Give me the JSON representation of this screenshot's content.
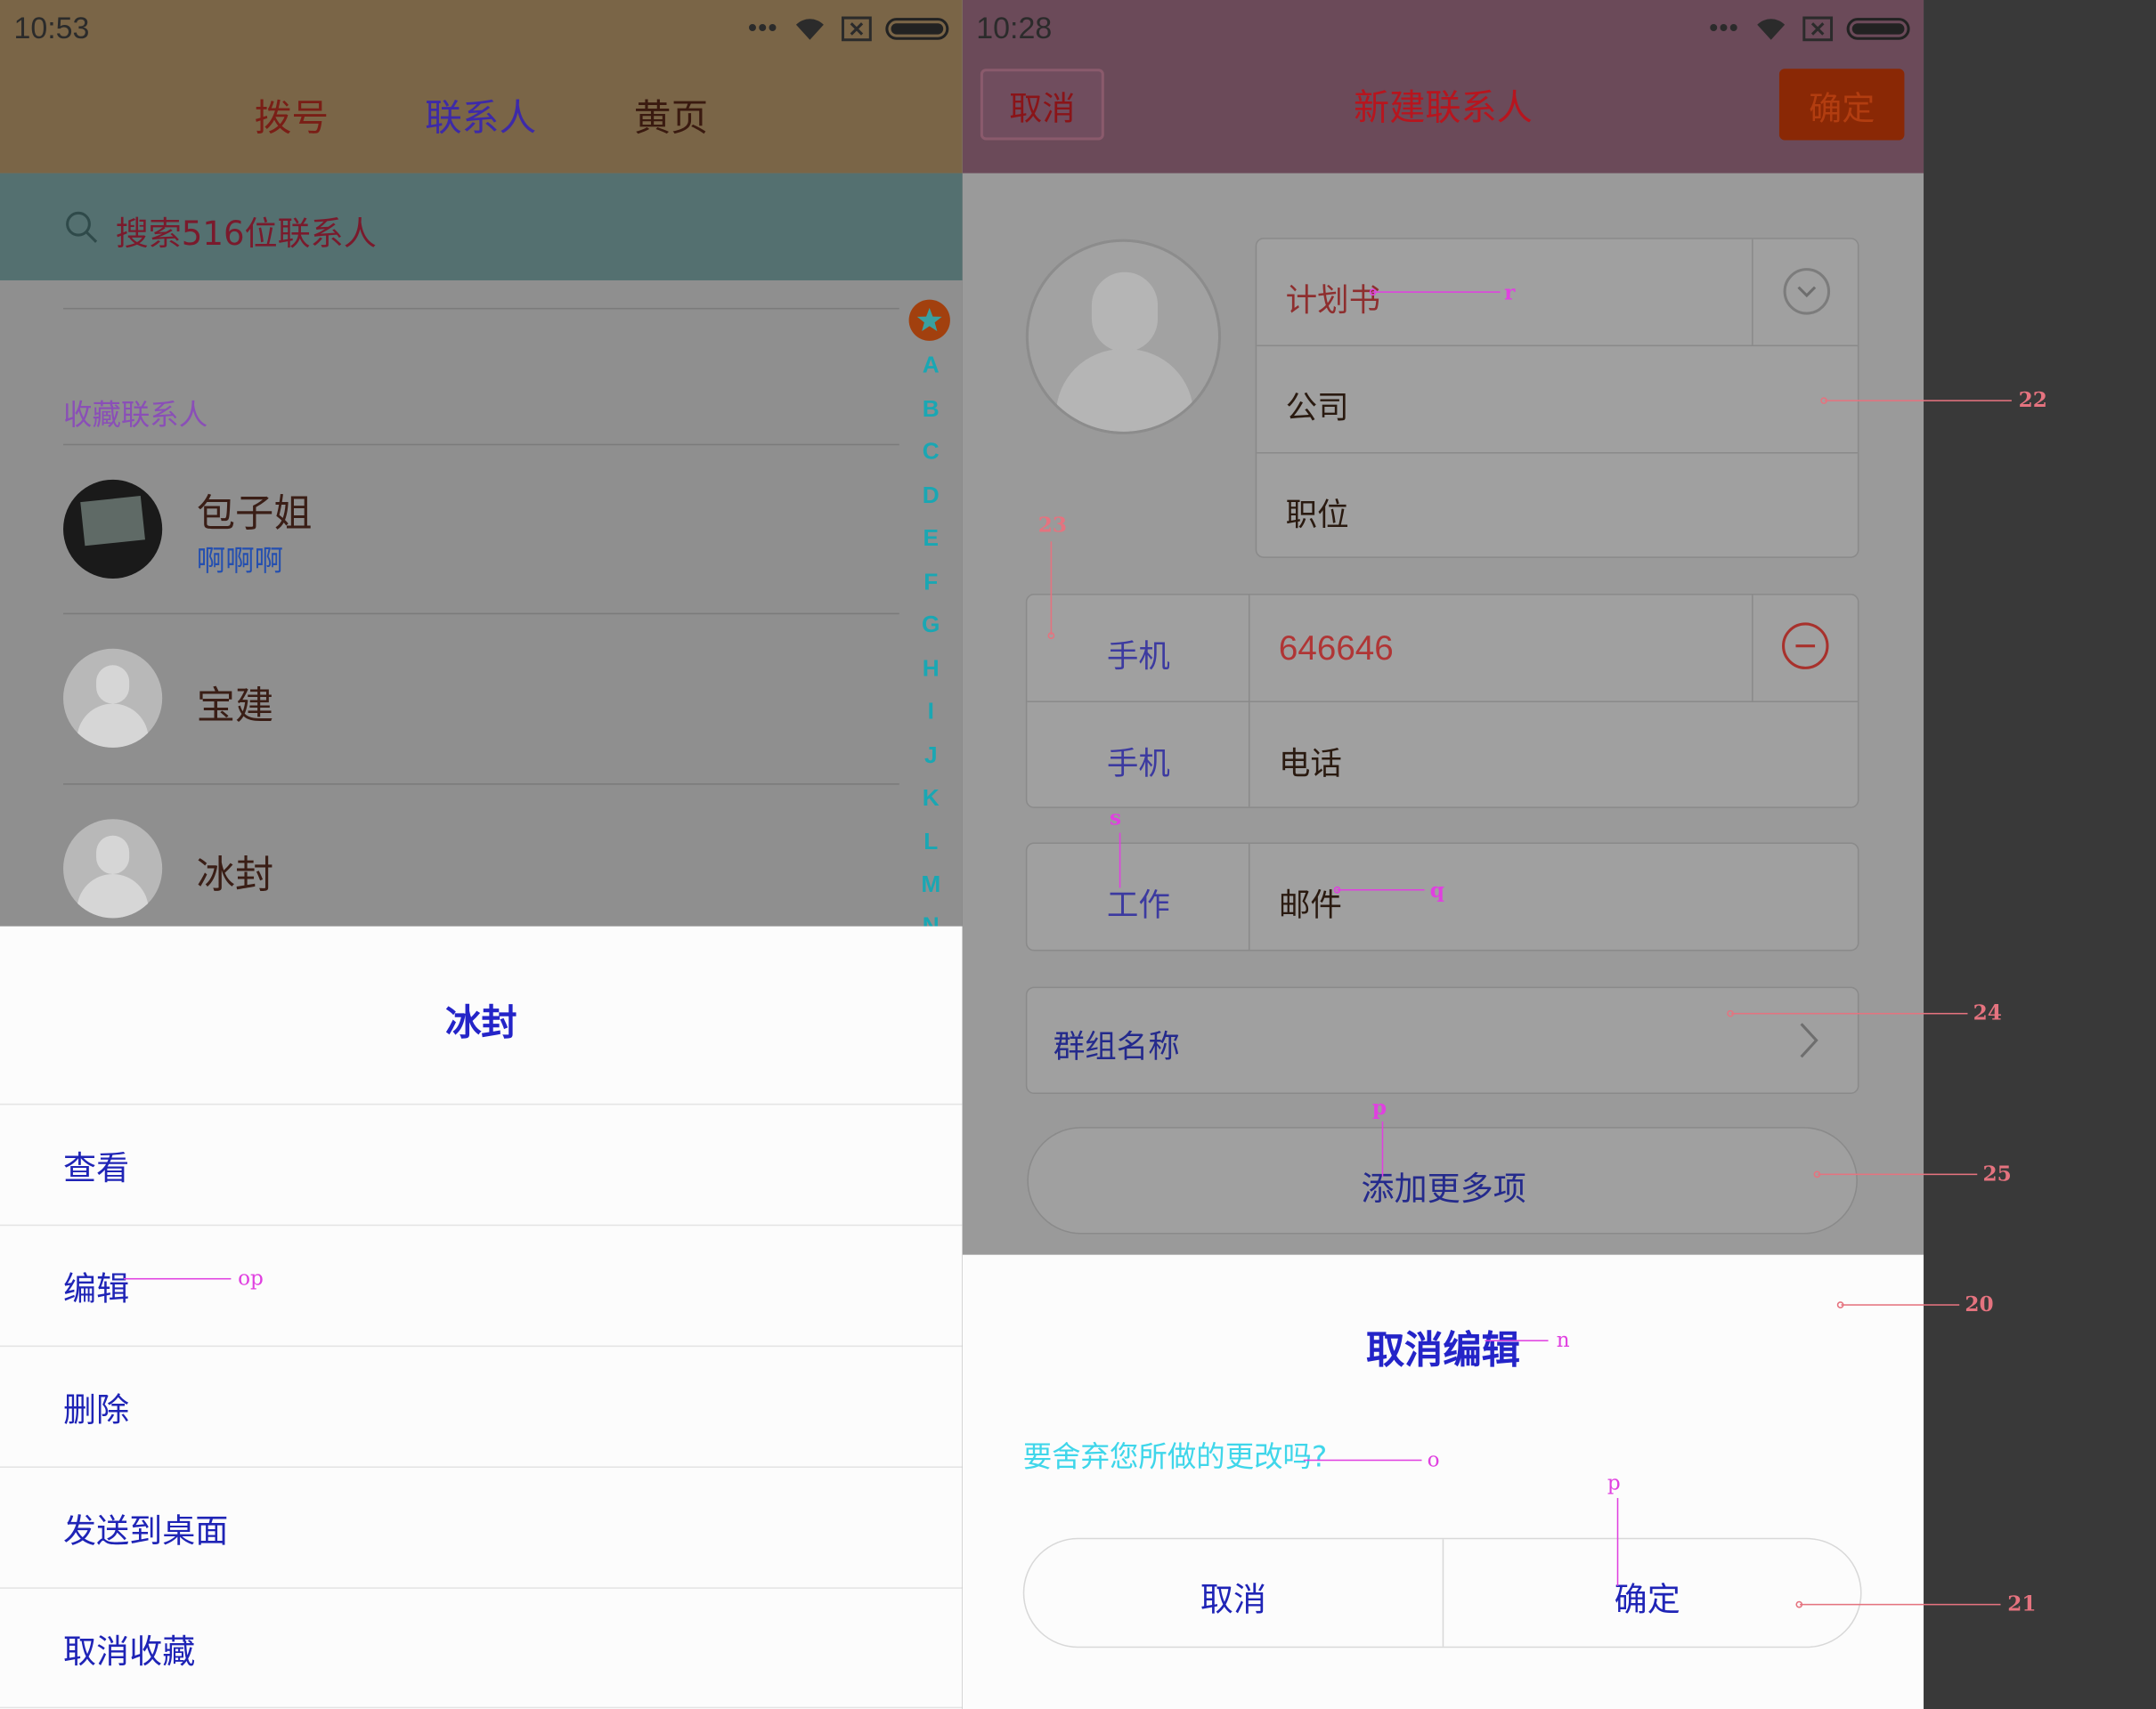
{
  "left": {
    "status": {
      "time": "10:53"
    },
    "tabs": [
      "拨号",
      "联系人",
      "黄页"
    ],
    "search": {
      "placeholder": "搜索516位联系人"
    },
    "section_label": "收藏联系人",
    "contacts": [
      {
        "name": "包子姐",
        "sub": "啊啊啊"
      },
      {
        "name": "宝建",
        "sub": ""
      },
      {
        "name": "冰封",
        "sub": ""
      }
    ],
    "index_letters": [
      "A",
      "B",
      "C",
      "D",
      "E",
      "F",
      "G",
      "H",
      "I",
      "J",
      "K",
      "L",
      "M",
      "N"
    ],
    "sheet": {
      "title": "冰封",
      "items": [
        "查看",
        "编辑",
        "删除",
        "发送到桌面",
        "取消收藏"
      ]
    }
  },
  "right": {
    "status": {
      "time": "10:28"
    },
    "header": {
      "cancel": "取消",
      "title": "新建联系人",
      "confirm": "确定"
    },
    "fields": {
      "note": "计划书",
      "company": "公司",
      "position": "职位",
      "phone1_label": "手机",
      "phone1_value": "646646",
      "phone2_label": "手机",
      "phone2_placeholder": "电话",
      "email_label": "工作",
      "email_placeholder": "邮件",
      "group": "群组名称",
      "add_more": "添加更多项"
    },
    "dialog": {
      "title": "取消编辑",
      "message": "要舍弃您所做的更改吗?",
      "cancel": "取消",
      "confirm": "确定"
    }
  },
  "annotations": {
    "labels": [
      "r",
      "22",
      "23",
      "s",
      "q",
      "24",
      "p",
      "25",
      "20",
      "n",
      "o",
      "p",
      "21",
      "op"
    ]
  },
  "colors": {
    "sheet_text": "#1f24b6",
    "annotation_red": "#e5737f",
    "annotation_magenta": "#e040e0",
    "annotation_cyan": "#40e0f0"
  }
}
